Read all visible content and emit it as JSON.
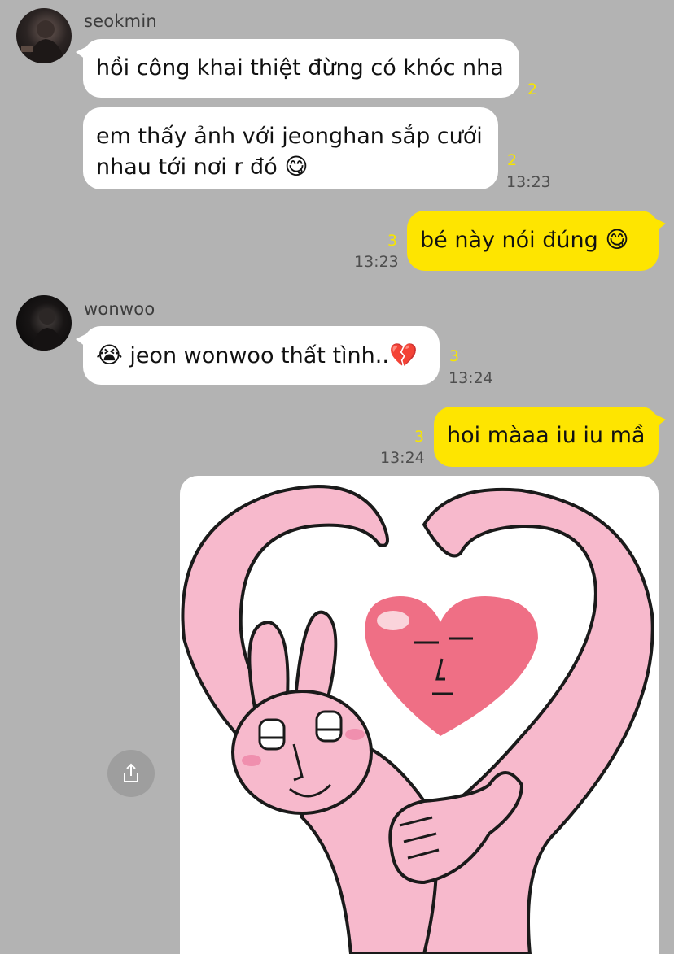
{
  "messages": [
    {
      "sender": "seokmin",
      "text": "hồi công khai thiệt đừng có khóc nha",
      "unread": "2"
    },
    {
      "sender": "seokmin",
      "text_line1": "em thấy ảnh với jeonghan sắp cưới",
      "text_line2": "nhau tới nơi r đó",
      "emoji": "😋",
      "unread": "2",
      "time": "13:23"
    },
    {
      "sender": "me",
      "text": "bé này nói đúng",
      "emoji": "😋",
      "unread": "3",
      "time": "13:23"
    },
    {
      "sender": "wonwoo",
      "emoji_pre": "😭",
      "text": "jeon wonwoo thất tình..",
      "emoji": "💔",
      "unread": "3",
      "time": "13:24"
    },
    {
      "sender": "me",
      "text": "hoi màaa iu iu mầ",
      "unread": "3",
      "time": "13:24"
    }
  ],
  "senders": {
    "seokmin": "seokmin",
    "wonwoo": "wonwoo"
  },
  "icons": {
    "share": "share-icon",
    "avatar_seokmin": "avatar-seokmin",
    "avatar_wonwoo": "avatar-wonwoo",
    "sticker": "bunny-heart-sticker"
  },
  "colors": {
    "background": "#b3b3b3",
    "my_bubble": "#fee500",
    "their_bubble": "#ffffff",
    "unread": "#f6e500"
  }
}
